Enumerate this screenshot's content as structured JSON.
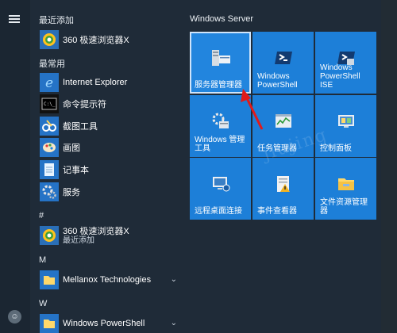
{
  "accent_color": "#1d7fd8",
  "rail": {
    "menu_icon": "hamburger-menu-icon",
    "user_icon": "user-avatar-icon",
    "user_glyph": "☺"
  },
  "applist": {
    "recent_header": "最近添加",
    "recent_app": {
      "label": "360 极速浏览器X",
      "icon": "browser-360-icon"
    },
    "frequent_header": "最常用",
    "frequent": [
      {
        "label": "Internet Explorer",
        "icon": "internet-explorer-icon"
      },
      {
        "label": "命令提示符",
        "icon": "command-prompt-icon"
      },
      {
        "label": "截图工具",
        "icon": "snipping-tool-icon"
      },
      {
        "label": "画图",
        "icon": "paint-icon"
      },
      {
        "label": "记事本",
        "icon": "notepad-icon"
      },
      {
        "label": "服务",
        "icon": "services-gear-icon"
      }
    ],
    "hash_header": "#",
    "hash_app": {
      "label": "360 极速浏览器X",
      "sub": "最近添加",
      "icon": "browser-360-icon"
    },
    "m_header": "M",
    "m_app": {
      "label": "Mellanox Technologies",
      "icon": "folder-icon"
    },
    "w_header": "W",
    "w_app": {
      "label": "Windows PowerShell",
      "icon": "folder-icon"
    }
  },
  "tiles": {
    "group_title": "Windows Server",
    "items": [
      {
        "label": "服务器管理器",
        "icon": "server-manager-icon"
      },
      {
        "label": "Windows PowerShell",
        "icon": "powershell-icon"
      },
      {
        "label": "Windows PowerShell ISE",
        "icon": "powershell-ise-icon"
      },
      {
        "label": "Windows 管理工具",
        "icon": "admin-tools-icon"
      },
      {
        "label": "任务管理器",
        "icon": "task-manager-icon"
      },
      {
        "label": "控制面板",
        "icon": "control-panel-icon"
      },
      {
        "label": "远程桌面连接",
        "icon": "remote-desktop-icon"
      },
      {
        "label": "事件查看器",
        "icon": "event-viewer-icon"
      },
      {
        "label": "文件资源管理器",
        "icon": "file-explorer-icon"
      }
    ]
  },
  "watermark": "jiujing"
}
